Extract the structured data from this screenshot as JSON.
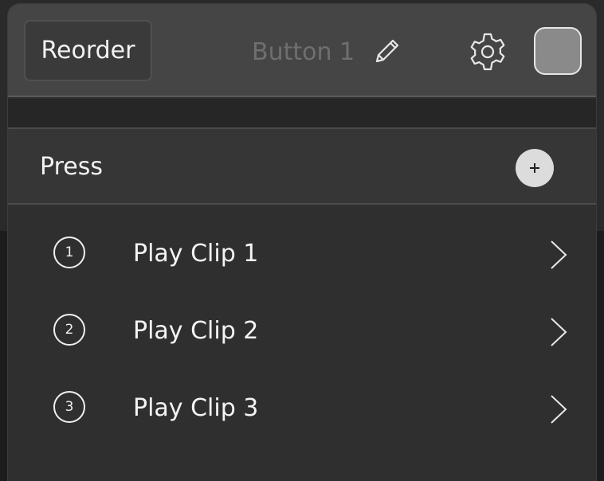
{
  "header": {
    "reorder_label": "Reorder",
    "title": "Button 1",
    "edit_icon": "pencil-icon",
    "settings_icon": "gear-icon",
    "color_swatch": "#8a8a8a"
  },
  "section": {
    "label": "Press",
    "add_icon": "plus-icon"
  },
  "actions": [
    {
      "number": "1",
      "label": "Play Clip 1"
    },
    {
      "number": "2",
      "label": "Play Clip 2"
    },
    {
      "number": "3",
      "label": "Play Clip 3"
    }
  ]
}
